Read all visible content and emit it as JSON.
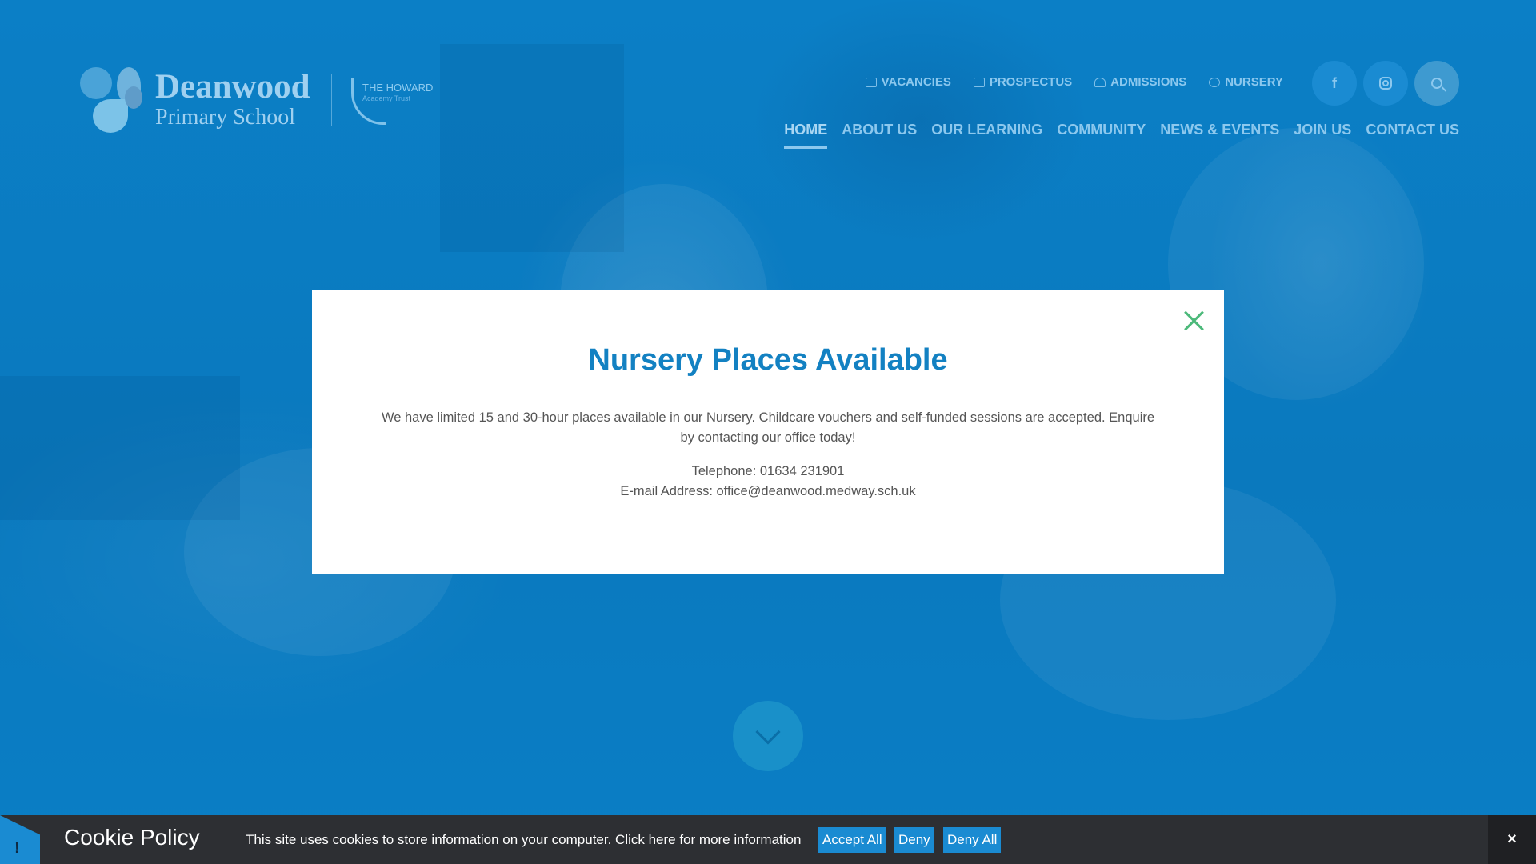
{
  "colors": {
    "hero_overlay": "#0a7cc4",
    "modal_title": "#1381c2",
    "modal_close": "#4cb97a",
    "cookie_bg": "#2d2f33",
    "cookie_button": "#1a8bd2"
  },
  "header": {
    "logo": {
      "line1": "Deanwood",
      "line2": "Primary School",
      "icon": "leaf-flower-logo-icon"
    },
    "trust": {
      "line1": "THE HOWARD",
      "line2": "Academy Trust"
    },
    "quick_links": [
      {
        "label": "VACANCIES",
        "icon": "briefcase-icon"
      },
      {
        "label": "PROSPECTUS",
        "icon": "book-icon"
      },
      {
        "label": "ADMISSIONS",
        "icon": "user-plus-icon"
      },
      {
        "label": "NURSERY",
        "icon": "hand-icon"
      }
    ],
    "social": [
      {
        "name": "facebook",
        "icon": "facebook-icon",
        "glyph": "f"
      },
      {
        "name": "instagram",
        "icon": "instagram-icon"
      },
      {
        "name": "search",
        "icon": "search-icon"
      }
    ],
    "nav": [
      {
        "label": "HOME",
        "active": true
      },
      {
        "label": "ABOUT US"
      },
      {
        "label": "OUR LEARNING"
      },
      {
        "label": "COMMUNITY"
      },
      {
        "label": "NEWS & EVENTS"
      },
      {
        "label": "JOIN US"
      },
      {
        "label": "CONTACT US"
      }
    ]
  },
  "modal": {
    "title": "Nursery Places Available",
    "body": "We have limited 15 and 30-hour places available in our Nursery. Childcare vouchers and self-funded sessions are accepted. Enquire by contacting our office today!",
    "telephone": "Telephone: 01634 231901",
    "email": "E-mail Address: office@deanwood.medway.sch.uk",
    "close_icon": "close-icon"
  },
  "scroll_icon": "chevron-down-icon",
  "cookie": {
    "flag_glyph": "!",
    "title": "Cookie Policy",
    "text": "This site uses cookies to store information on your computer. Click here for more information",
    "accept_all": "Accept All",
    "deny": "Deny",
    "deny_all": "Deny All",
    "close_glyph": "×"
  }
}
